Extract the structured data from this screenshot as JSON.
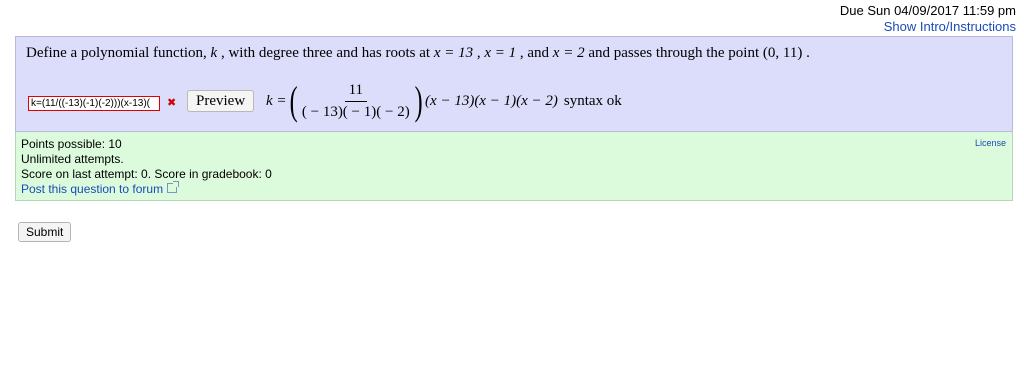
{
  "header": {
    "due_date": "Due Sun 04/09/2017 11:59 pm",
    "show_intro_link": "Show Intro/Instructions"
  },
  "question": {
    "text_part1": "Define a polynomial function, ",
    "var_k": "k",
    "text_part2": " , with degree three and has roots at ",
    "root1": "x = 13",
    "sep1": " , ",
    "root2": "x = 1",
    "sep2": " , and ",
    "root3": "x = 2",
    "text_part3": "  and passes through the point ",
    "point": "(0, 11)",
    "text_end": " ."
  },
  "answer": {
    "input_value": "k=(11/((-13)(-1)(-2)))(x-13)(",
    "status_icon": "x-mark-icon",
    "preview_label": "Preview",
    "preview_lhs": "k =",
    "fraction_numerator": "11",
    "fraction_denominator": "( − 13)( − 1)( − 2)",
    "preview_rhs": "(x − 13)(x − 1)(x − 2)",
    "syntax_status": "syntax ok"
  },
  "info": {
    "points_possible": "Points possible: 10",
    "attempts": "Unlimited attempts.",
    "score": "Score on last attempt: 0. Score in gradebook: 0",
    "forum_link": "Post this question to forum",
    "license_link": "License"
  },
  "submit_label": "Submit",
  "colors": {
    "question_bg": "#dcdcfb",
    "info_bg": "#dcfadc",
    "link": "#1a4bb8",
    "error": "#d00000"
  }
}
